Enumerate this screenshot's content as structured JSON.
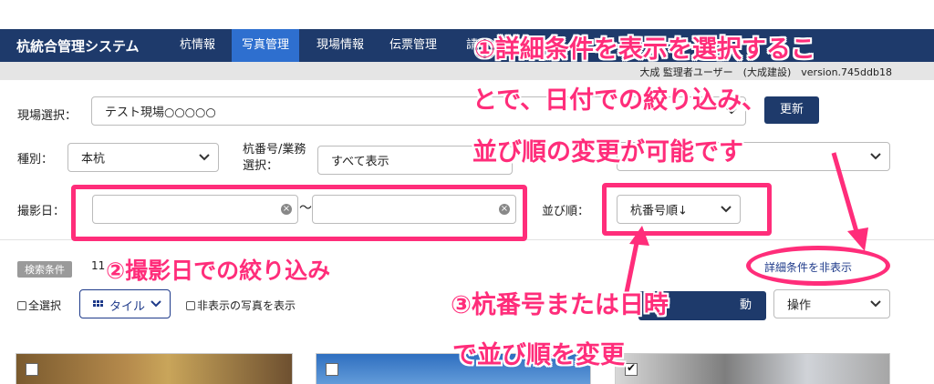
{
  "app": {
    "title": "杭統合管理システム"
  },
  "nav": {
    "items": [
      {
        "label": "杭情報"
      },
      {
        "label": "写真管理"
      },
      {
        "label": "現場情報"
      },
      {
        "label": "伝票管理"
      },
      {
        "label": "請"
      }
    ],
    "active_index": 1
  },
  "userinfo": "大成 監理者ユーザー　(大成建設)　version.745ddb18",
  "form": {
    "site_label": "現場選択：",
    "site_value": "テスト現場○○○○○",
    "update_button": "更新",
    "type_label": "種別：",
    "type_value": "本杭",
    "pile_label_1": "杭番号/業務",
    "pile_label_2": "選択：",
    "pile_value": "すべて表示",
    "date_label": "撮影日：",
    "date_from": "",
    "date_to": "",
    "date_sep": "〜",
    "sort_label": "並び順：",
    "sort_value": "杭番号順↓"
  },
  "search": {
    "badge": "検索条件",
    "count_prefix": "11",
    "toggle_link": "詳細条件を非表示"
  },
  "toolbar": {
    "select_all": "全選択",
    "view_mode": "タイル",
    "show_hidden": "非表示の写真を表示",
    "move_button": "動",
    "operation_select": "操作"
  },
  "annotations": {
    "note1_line1": "①詳細条件を表示を選択するこ",
    "note1_line2": "とで、日付での絞り込み、",
    "note1_line3": "並び順の変更が可能です",
    "note2": "②撮影日での絞り込み",
    "note3_line1": "③杭番号または日時",
    "note3_line2": "で並び順を変更"
  },
  "colors": {
    "nav_bg": "#1e3a6b",
    "nav_active": "#2e6fcf",
    "annotation": "#ff2d7a",
    "link": "#1e3a8a"
  }
}
